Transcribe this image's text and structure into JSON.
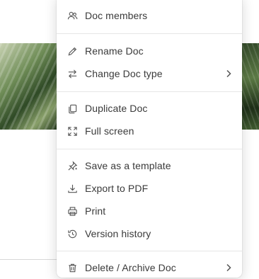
{
  "menu": {
    "groups": [
      {
        "items": [
          {
            "label": "Doc members",
            "icon": "people-icon"
          }
        ]
      },
      {
        "items": [
          {
            "label": "Rename Doc",
            "icon": "pencil-icon"
          },
          {
            "label": "Change Doc type",
            "icon": "swap-arrows-icon",
            "submenu": true
          }
        ]
      },
      {
        "items": [
          {
            "label": "Duplicate Doc",
            "icon": "copy-icon"
          },
          {
            "label": "Full screen",
            "icon": "expand-icon"
          }
        ]
      },
      {
        "items": [
          {
            "label": "Save as a template",
            "icon": "template-pin-icon"
          },
          {
            "label": "Export to PDF",
            "icon": "download-icon"
          },
          {
            "label": "Print",
            "icon": "printer-icon"
          },
          {
            "label": "Version history",
            "icon": "history-icon"
          }
        ]
      },
      {
        "items": [
          {
            "label": "Delete / Archive Doc",
            "icon": "trash-icon",
            "submenu": true
          }
        ]
      }
    ]
  },
  "colors": {
    "text": "#3a3a3a",
    "icon": "#555555",
    "separator": "#e6e6e6"
  }
}
